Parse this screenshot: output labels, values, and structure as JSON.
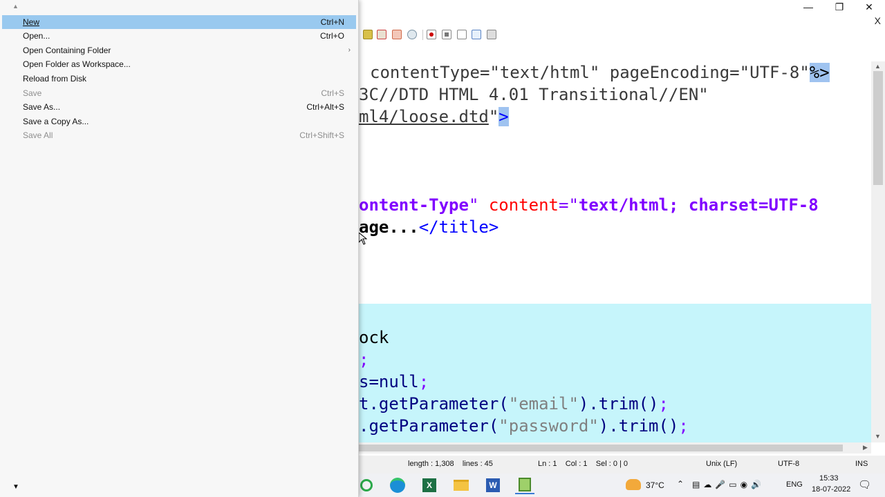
{
  "window": {
    "tab_close": "X"
  },
  "menu": {
    "items": [
      {
        "label": "New",
        "shortcut": "Ctrl+N",
        "enabled": true,
        "selected": true
      },
      {
        "label": "Open...",
        "shortcut": "Ctrl+O",
        "enabled": true
      },
      {
        "label": "Open Containing Folder",
        "shortcut": "",
        "enabled": true,
        "submenu": true
      },
      {
        "label": "Open Folder as Workspace...",
        "shortcut": "",
        "enabled": true
      },
      {
        "label": "Reload from Disk",
        "shortcut": "",
        "enabled": true
      },
      {
        "label": "Save",
        "shortcut": "Ctrl+S",
        "enabled": false
      },
      {
        "label": "Save As...",
        "shortcut": "Ctrl+Alt+S",
        "enabled": true
      },
      {
        "label": "Save a Copy As...",
        "shortcut": "",
        "enabled": true
      },
      {
        "label": "Save All",
        "shortcut": "Ctrl+Shift+S",
        "enabled": false
      }
    ]
  },
  "code": {
    "l1": "contentType=\"text/html\" pageEncoding=\"UTF-8\"",
    "l1_end": "%>",
    "l2": "3C//DTD HTML 4.01 Transitional//EN\"",
    "l3a": "ml4/loose.dtd",
    "l3b": "\"",
    "l3c": ">",
    "l7a": "ontent-Type",
    "l7b": "\" ",
    "l7c": "content",
    "l7d": "=\"",
    "l7e": "text/html; charset=UTF-8",
    "l8a": "age...",
    "l8b": "</title>",
    "l13": "ock",
    "l14": ";",
    "l15a": "s=null",
    "l15b": ";",
    "l16a": "t.getParameter(",
    "l16b": "\"email\"",
    "l16c": ").trim()",
    "l16d": ";",
    "l17a": ".getParameter(",
    "l17b": "\"password\"",
    "l17c": ").trim()",
    "l17d": ";"
  },
  "status": {
    "length": "length : 1,308    lines : 45",
    "position": "Ln : 1    Col : 1    Sel : 0 | 0",
    "eol": "Unix (LF)",
    "encoding": "UTF-8",
    "mode": "INS"
  },
  "taskbar": {
    "temperature": "37°C",
    "language": "ENG",
    "time": "15:33",
    "date": "18-07-2022"
  },
  "colors": {
    "menu_selected": "#99c9ef",
    "highlight_block": "#c6f5fb",
    "keyword_purple": "#8000ff",
    "attribute_red": "#ff0000",
    "tag_blue": "#0000ff"
  }
}
